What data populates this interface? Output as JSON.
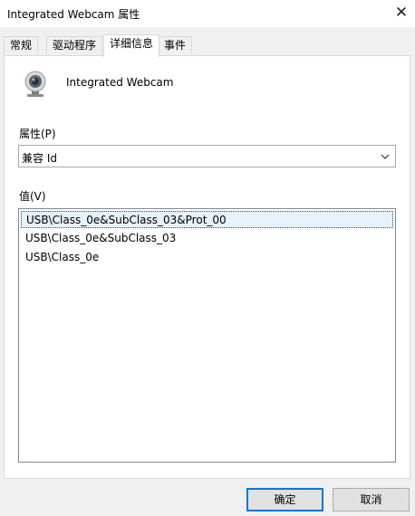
{
  "window": {
    "title": "Integrated Webcam 属性",
    "close_symbol": "✕"
  },
  "tabs": [
    {
      "label": "常规",
      "active": false
    },
    {
      "label": "驱动程序",
      "active": false
    },
    {
      "label": "详细信息",
      "active": true
    },
    {
      "label": "事件",
      "active": false
    }
  ],
  "device": {
    "name": "Integrated Webcam",
    "icon": "webcam-icon"
  },
  "property": {
    "label": "属性(P)",
    "selected": "兼容 Id"
  },
  "value": {
    "label": "值(V)",
    "items": [
      "USB\\Class_0e&SubClass_03&Prot_00",
      "USB\\Class_0e&SubClass_03",
      "USB\\Class_0e"
    ],
    "selected_index": 0
  },
  "buttons": {
    "ok": "确定",
    "cancel": "取消"
  },
  "colors": {
    "accent": "#0078d7",
    "selection": "#e5f1fb"
  }
}
